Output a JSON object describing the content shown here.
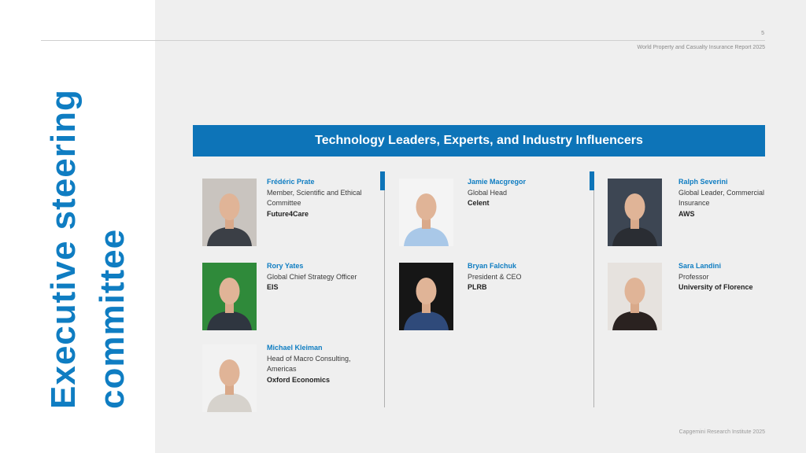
{
  "header": {
    "page_number": "5",
    "report_title": "World Property and Casualty Insurance Report 2025"
  },
  "side_title": {
    "line1": "Executive steering",
    "line2": "committee"
  },
  "banner": {
    "title": "Technology Leaders, Experts, and Industry Influencers"
  },
  "people": [
    {
      "name": "Frédéric Prate",
      "role": "Member, Scientific and Ethical Committee",
      "org": "Future4Care",
      "photo_bg": "#c9c4bf",
      "shirt": "#3b3f46"
    },
    {
      "name": "Jamie Macgregor",
      "role": "Global Head",
      "org": "Celent",
      "photo_bg": "#f4f4f4",
      "shirt": "#a9c8e8"
    },
    {
      "name": "Ralph Severini",
      "role": "Global Leader, Commercial Insurance",
      "org": "AWS",
      "photo_bg": "#3d4653",
      "shirt": "#2a2d33"
    },
    {
      "name": "Rory Yates",
      "role": "Global Chief Strategy Officer",
      "org": "EIS",
      "photo_bg": "#2f8a3a",
      "shirt": "#2f3640"
    },
    {
      "name": "Bryan Falchuk",
      "role": "President & CEO",
      "org": "PLRB",
      "photo_bg": "#161616",
      "shirt": "#2f4a7a"
    },
    {
      "name": "Sara Landini",
      "role": "Professor",
      "org": "University of Florence",
      "photo_bg": "#e6e2de",
      "shirt": "#2a2220"
    },
    {
      "name": "Michael Kleiman",
      "role": "Head of Macro Consulting, Americas",
      "org": "Oxford Economics",
      "photo_bg": "#f2f2f2",
      "shirt": "#d6d2cc"
    }
  ],
  "footer": {
    "text": "Capgemini Research Institute 2025"
  }
}
